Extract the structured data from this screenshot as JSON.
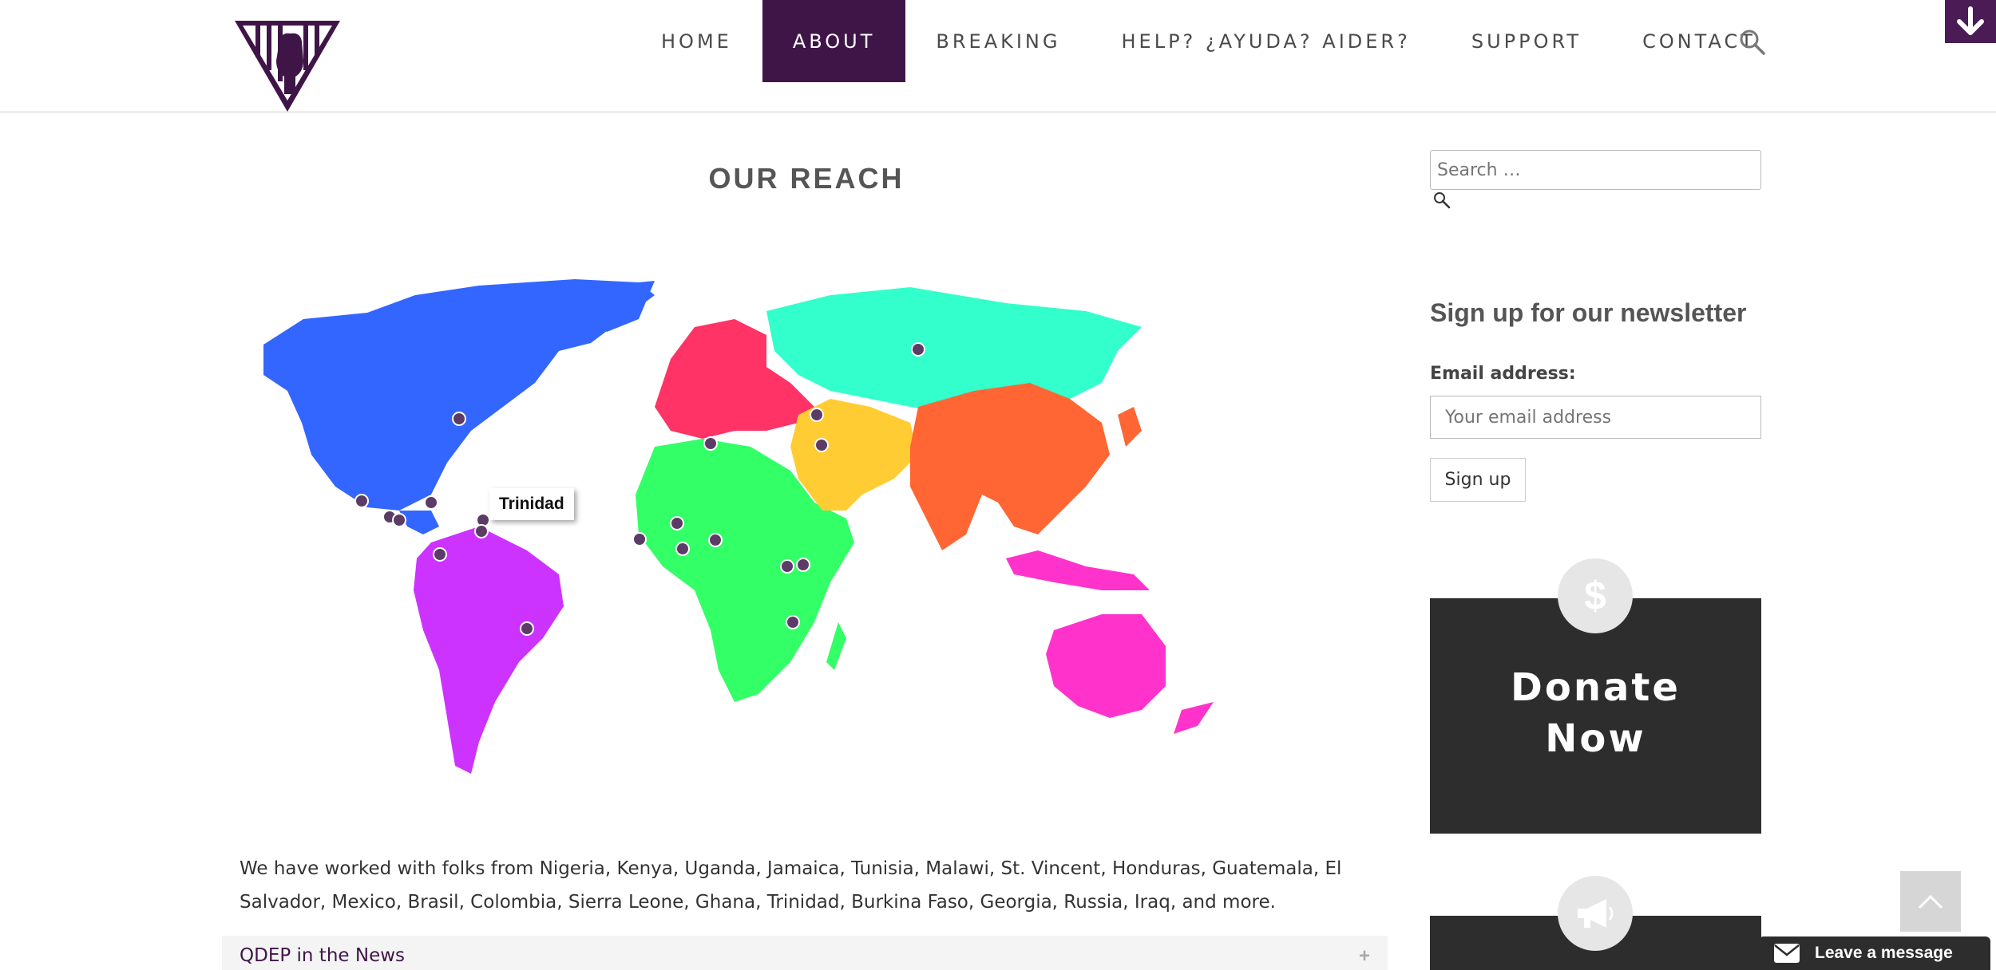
{
  "nav": {
    "items": [
      {
        "label": "HOME"
      },
      {
        "label": "ABOUT",
        "active": true
      },
      {
        "label": "BREAKING"
      },
      {
        "label": "HELP? ¿AYUDA? AIDER?"
      },
      {
        "label": "SUPPORT"
      },
      {
        "label": "CONTACT"
      }
    ]
  },
  "main": {
    "title": "OUR REACH",
    "tooltip": "Trinidad",
    "body": "We have worked with folks from Nigeria, Kenya, Uganda, Jamaica, Tunisia, Malawi, St. Vincent, Honduras, Guatemala, El Salvador, Mexico, Brasil, Colombia, Sierra Leone, Ghana, Trinidad, Burkina Faso, Georgia, Russia, Iraq, and more.",
    "news_label": "QDEP in the News",
    "news_toggle": "+"
  },
  "sidebar": {
    "search_placeholder": "Search …",
    "newsletter_title": "Sign up for our newsletter",
    "email_label": "Email address:",
    "email_placeholder": "Your email address",
    "signup_label": "Sign up",
    "donate_line1": "Donate",
    "donate_line2": "Now",
    "donate_symbol": "$"
  },
  "chat": {
    "label": "Leave a message"
  },
  "colors": {
    "brand": "#3f1548",
    "north_america": "#3366ff",
    "south_america": "#cc33ff",
    "europe": "#ff3366",
    "africa": "#33ff66",
    "middle_east": "#ffcc33",
    "russia": "#33ffcc",
    "asia": "#ff6633",
    "oceania": "#ff33cc",
    "marker": "#5c3c66"
  }
}
